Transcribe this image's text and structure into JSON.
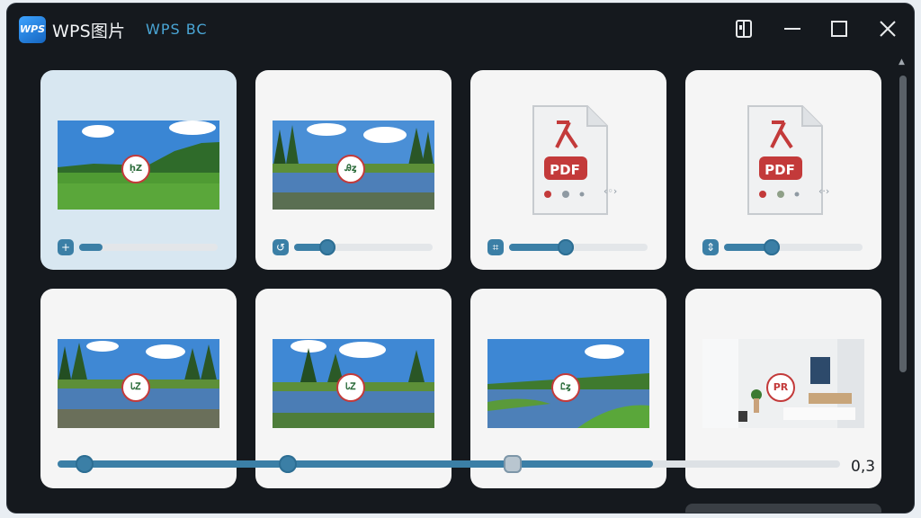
{
  "window": {
    "app_title": "WPS图片",
    "app_subtitle": "WPS BC",
    "logo_text": "WPS"
  },
  "titlebar_buttons": [
    "tablet-mode-icon",
    "minimize-icon",
    "maximize-icon",
    "close-icon"
  ],
  "colors": {
    "accent": "#3b7fa6",
    "window_bg": "#15191e",
    "card_bg": "#f5f5f5",
    "selected_card_bg": "#d8e7f1",
    "pdf_red": "#c33a3a"
  },
  "cards": [
    {
      "type": "photo",
      "scene": "meadow",
      "badge": "ḥZ",
      "selected": true,
      "slider_level": 0.12
    },
    {
      "type": "photo",
      "scene": "lake-forest",
      "badge": "Ꭿȥ",
      "selected": false,
      "slider_level": 0.2
    },
    {
      "type": "pdf",
      "pdf_label": "PDF",
      "side_mark": "‹◦›",
      "selected": false,
      "slider_level": 0.4
    },
    {
      "type": "pdf",
      "pdf_label": "PDF",
      "side_mark": "‹·›",
      "selected": false,
      "slider_level": 0.35
    },
    {
      "type": "photo",
      "scene": "lake-forest",
      "badge": "ᏓᏃ",
      "selected": false
    },
    {
      "type": "photo",
      "scene": "lake-forest",
      "badge": "ᏓᏃ",
      "selected": false
    },
    {
      "type": "photo",
      "scene": "river",
      "badge": "Ꮭȥ",
      "selected": false
    },
    {
      "type": "photo",
      "scene": "room",
      "badge": "PR",
      "selected": false
    }
  ],
  "bottom_slider": {
    "level": 0.76,
    "zoom_value": "0,3"
  }
}
